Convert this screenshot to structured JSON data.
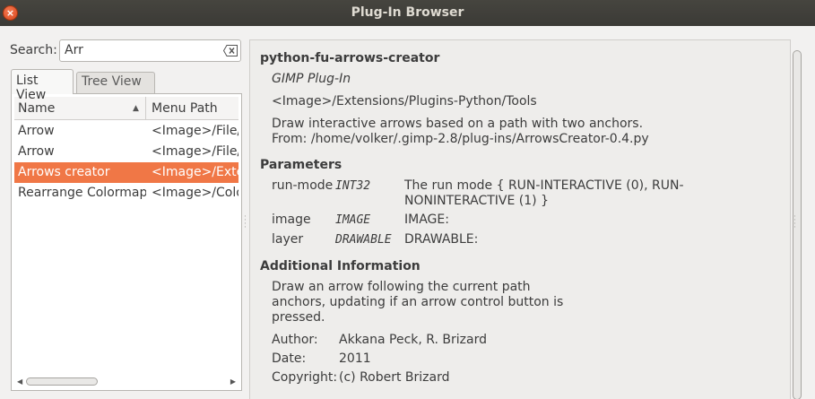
{
  "window": {
    "title": "Plug-In Browser",
    "close_glyph": "×"
  },
  "search": {
    "label": "Search:",
    "value": "Arr"
  },
  "tabs": [
    {
      "label": "List View",
      "active": true
    },
    {
      "label": "Tree View",
      "active": false
    }
  ],
  "table": {
    "columns": [
      "Name",
      "Menu Path"
    ],
    "sort_glyph": "▲",
    "rows": [
      {
        "name": "Arrow",
        "path": "<Image>/File/C"
      },
      {
        "name": "Arrow",
        "path": "<Image>/File/C"
      },
      {
        "name": "Arrows creator",
        "path": "<Image>/Exten",
        "selected": true
      },
      {
        "name": "Rearrange Colormap",
        "path": "<Image>/Color"
      }
    ],
    "scroll_left": "◀",
    "scroll_right": "▶",
    "grip": "⦙"
  },
  "detail": {
    "proc_name": "python-fu-arrows-creator",
    "proc_type": "GIMP Plug-In",
    "menu_path": "<Image>/Extensions/Plugins-Python/Tools",
    "blurb_line1": "Draw interactive arrows based on a path with two anchors.",
    "blurb_line2": "From: /home/volker/.gimp-2.8/plug-ins/ArrowsCreator-0.4.py",
    "parameters_heading": "Parameters",
    "params": [
      {
        "name": "run-mode",
        "type": "INT32",
        "desc1": "The run mode { RUN-INTERACTIVE (0), RUN-",
        "desc2": "NONINTERACTIVE (1) }"
      },
      {
        "name": "image",
        "type": "IMAGE",
        "desc1": "IMAGE:",
        "desc2": ""
      },
      {
        "name": "layer",
        "type": "DRAWABLE",
        "desc1": "DRAWABLE:",
        "desc2": ""
      }
    ],
    "additional_heading": "Additional Information",
    "help_line1": "Draw an arrow following the current path",
    "help_line2": "anchors, updating if an arrow control button is",
    "help_line3": "pressed.",
    "author_label": "Author:",
    "author": "Akkana Peck, R. Brizard",
    "date_label": "Date:",
    "date": "2011",
    "copyright_label": "Copyright:",
    "copyright": "(c) Robert Brizard"
  },
  "icons": {
    "clear": "clear-text-icon",
    "close": "close-icon"
  },
  "colors": {
    "selection": "#f07746",
    "titlebar": "#3b3a36",
    "close": "#e5592a"
  }
}
